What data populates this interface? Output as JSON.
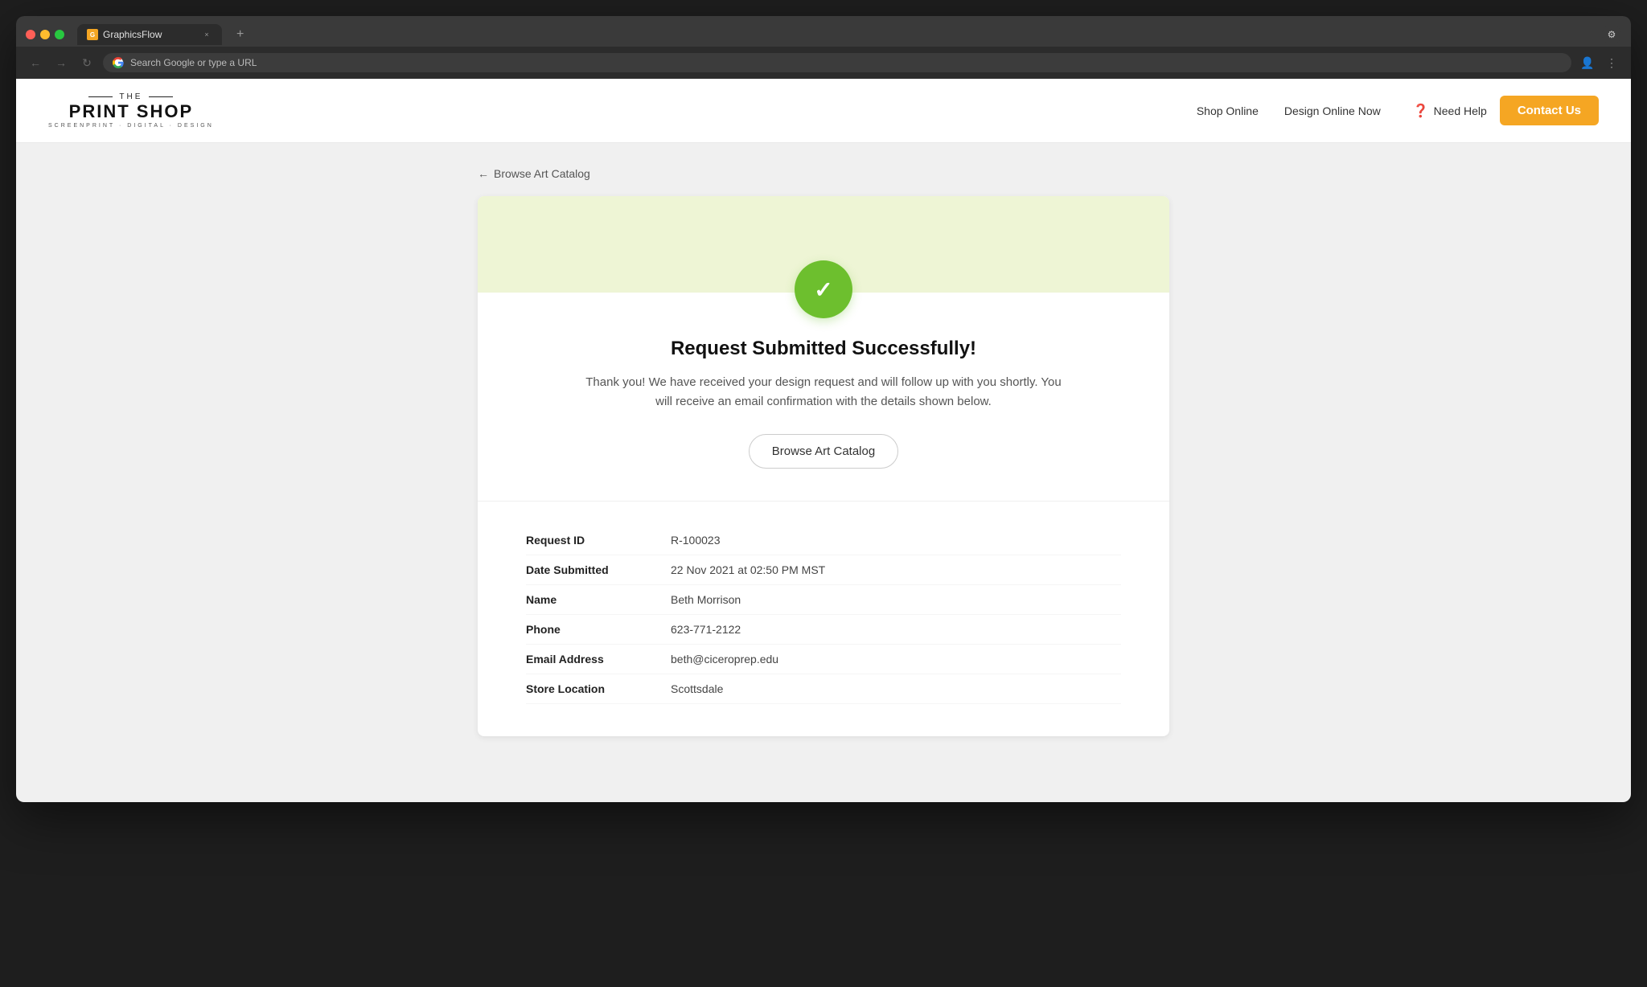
{
  "browser": {
    "tab_title": "GraphicsFlow",
    "tab_favicon": "G",
    "address_bar_text": "Search Google or type a URL",
    "new_tab_symbol": "+",
    "close_tab": "×",
    "nav_back": "←",
    "nav_forward": "→",
    "nav_refresh": "↻",
    "dots_icon": "⋮",
    "profile_icon": "👤"
  },
  "header": {
    "logo_the": "THE",
    "logo_main": "PRINT SHOP",
    "logo_sub": "SCREENPRINT · DIGITAL · DESIGN",
    "nav_links": [
      {
        "label": "Shop Online"
      },
      {
        "label": "Design Online Now"
      }
    ],
    "need_help": "Need Help",
    "contact_us": "Contact Us"
  },
  "page": {
    "breadcrumb": "Browse Art Catalog",
    "breadcrumb_arrow": "←",
    "success_title": "Request Submitted Successfully!",
    "success_desc": "Thank you! We have received your design request and will follow up with you shortly. You will receive an email confirmation with the details shown below.",
    "browse_btn": "Browse Art Catalog",
    "details": [
      {
        "label": "Request ID",
        "value": "R-100023"
      },
      {
        "label": "Date Submitted",
        "value": "22 Nov 2021 at 02:50 PM MST"
      },
      {
        "label": "Name",
        "value": "Beth Morrison"
      },
      {
        "label": "Phone",
        "value": "623-771-2122"
      },
      {
        "label": "Email Address",
        "value": "beth@ciceroprep.edu"
      },
      {
        "label": "Store Location",
        "value": "Scottsdale"
      }
    ]
  },
  "colors": {
    "accent_orange": "#f5a623",
    "success_green": "#6dbf2e",
    "banner_green_light": "#eef5d5"
  }
}
